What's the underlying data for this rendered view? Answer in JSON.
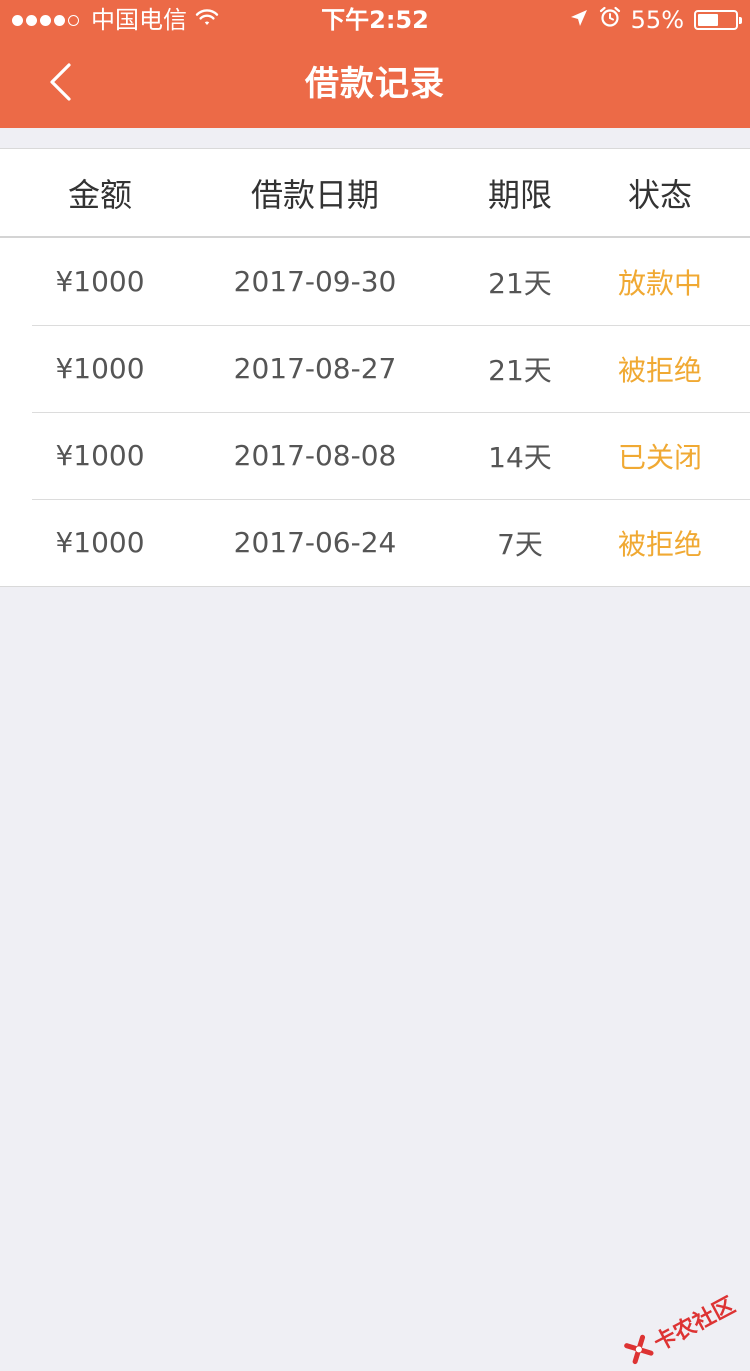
{
  "status_bar": {
    "carrier": "中国电信",
    "time": "下午2:52",
    "battery_percent": "55%",
    "battery_level": 0.55
  },
  "nav": {
    "title": "借款记录",
    "back_icon": "chevron-left-icon"
  },
  "table": {
    "headers": [
      "金额",
      "借款日期",
      "期限",
      "状态"
    ],
    "rows": [
      {
        "amount": "¥1000",
        "date": "2017-09-30",
        "term": "21天",
        "status": "放款中"
      },
      {
        "amount": "¥1000",
        "date": "2017-08-27",
        "term": "21天",
        "status": "被拒绝"
      },
      {
        "amount": "¥1000",
        "date": "2017-08-08",
        "term": "14天",
        "status": "已关闭"
      },
      {
        "amount": "¥1000",
        "date": "2017-06-24",
        "term": "7天",
        "status": "被拒绝"
      }
    ]
  },
  "watermark": {
    "text": "卡农社区"
  },
  "colors": {
    "accent": "#ec6a47",
    "status": "#f0a933",
    "background": "#efeff4"
  }
}
